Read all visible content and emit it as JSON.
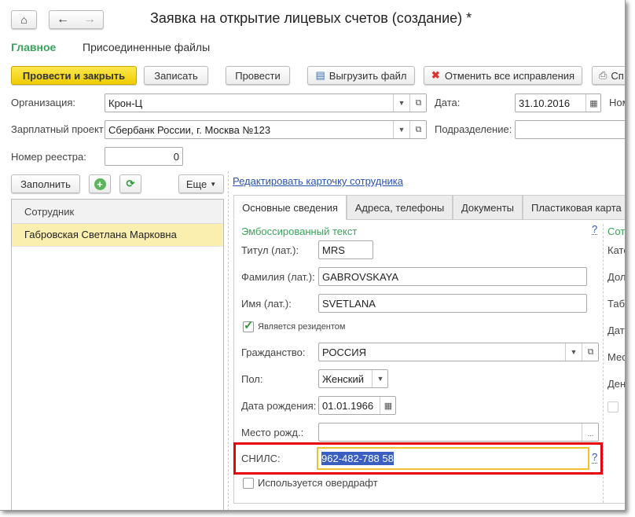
{
  "window": {
    "title": "Заявка на открытие лицевых счетов (создание) *"
  },
  "nav": {
    "home_icon": "home-icon",
    "back_icon": "arrow-left-icon",
    "forward_icon": "arrow-right-icon"
  },
  "sections": [
    {
      "label": "Главное",
      "active": true
    },
    {
      "label": "Присоединенные файлы",
      "active": false
    }
  ],
  "toolbar": {
    "post_close": "Провести и закрыть",
    "save": "Записать",
    "post": "Провести",
    "export": "Выгрузить файл",
    "cancel_fixes": "Отменить все исправления",
    "print": "Сп"
  },
  "header": {
    "org_label": "Организация:",
    "org_value": "Крон-Ц",
    "date_label": "Дата:",
    "date_value": "31.10.2016",
    "number_label": "Ном",
    "project_label": "Зарплатный проект:",
    "project_value": "Сбербанк России, г. Москва №123",
    "division_label": "Подразделение:",
    "division_value": "",
    "registry_label": "Номер реестра:",
    "registry_value": "0"
  },
  "left": {
    "fill": "Заполнить",
    "more": "Еще",
    "column": "Сотрудник",
    "rows": [
      "Габровская Светлана Марковна"
    ]
  },
  "edit_link": "Редактировать карточку сотрудника",
  "tabs": [
    {
      "label": "Основные сведения",
      "active": true
    },
    {
      "label": "Адреса, телефоны"
    },
    {
      "label": "Документы"
    },
    {
      "label": "Пластиковая карта"
    }
  ],
  "form": {
    "section": "Эмбоссированный текст",
    "help": "?",
    "title_label": "Титул (лат.):",
    "title_value": "MRS",
    "surname_label": "Фамилия (лат.):",
    "surname_value": "GABROVSKAYA",
    "name_label": "Имя (лат.):",
    "name_value": "SVETLANA",
    "resident_label": "Является резидентом",
    "resident_checked": true,
    "citizenship_label": "Гражданство:",
    "citizenship_value": "РОССИЯ",
    "gender_label": "Пол:",
    "gender_value": "Женский",
    "birth_label": "Дата рождения:",
    "birth_value": "01.01.1966",
    "birthplace_label": "Место рожд.:",
    "birthplace_value": "",
    "birthplace_btn": "...",
    "snils_label": "СНИЛС:",
    "snils_value": "962-482-788 58",
    "snils_help": "?",
    "overdraft_label": "Используется овердрафт",
    "overdraft_checked": false
  },
  "right_col": [
    "Сотр",
    "Кате",
    "Дол",
    "Табе",
    "Дата",
    "Мес",
    "Ден"
  ],
  "colors": {
    "accent_green": "#3aa35b",
    "primary_yellow": "#f5d800",
    "highlight_red": "#e8000b",
    "focus_yellow": "#f4c12e",
    "selected_row": "#fbefb0",
    "link_blue": "#2a53b5",
    "selection": "#3b5fc0"
  }
}
